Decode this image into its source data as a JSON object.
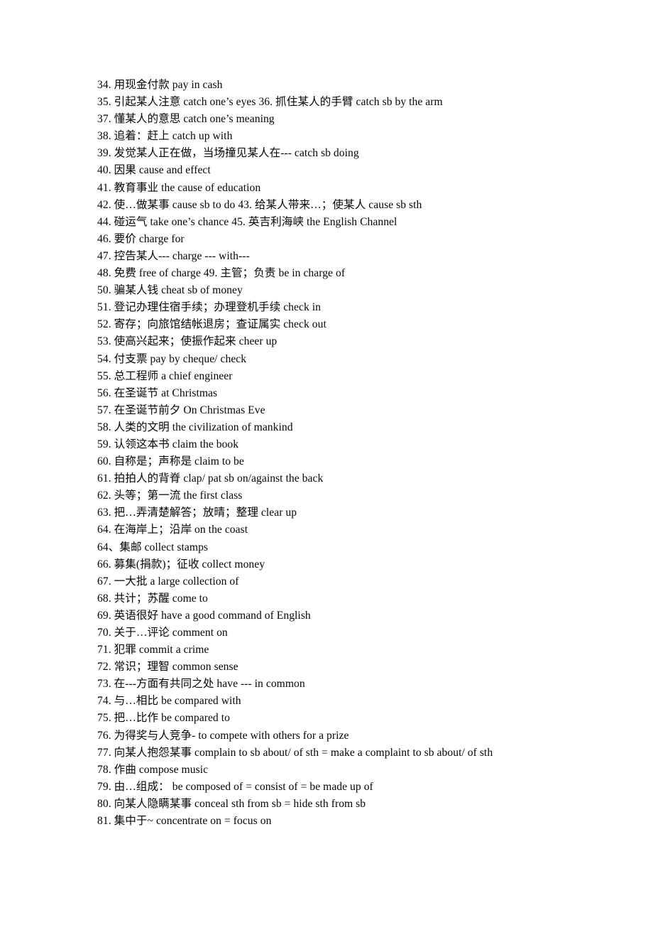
{
  "document": {
    "page_background": "#ffffff",
    "text_color": "#000000",
    "entries": [
      {
        "num": "34.",
        "text": "34.  用现金付款  pay in cash"
      },
      {
        "num": "35.",
        "text": "35.  引起某人注意  catch one’s eyes 36.  抓住某人的手臂  catch sb by the arm"
      },
      {
        "num": "37.",
        "text": "37.  懂某人的意思  catch one’s meaning"
      },
      {
        "num": "38.",
        "text": "38.  追着：赶上  catch up with"
      },
      {
        "num": "39.",
        "text": "39.  发觉某人正在做，当场撞见某人在--- catch sb doing"
      },
      {
        "num": "40.",
        "text": "40.  因果  cause and effect"
      },
      {
        "num": "41.",
        "text": "41.  教育事业  the cause of education"
      },
      {
        "num": "42.",
        "text": "42.  使…做某事  cause sb to do 43.  给某人带来…；使某人  cause sb sth"
      },
      {
        "num": "44.",
        "text": "44.  碰运气  take one’s chance 45.  英吉利海峡  the English Channel"
      },
      {
        "num": "46.",
        "text": "46.  要价  charge for"
      },
      {
        "num": "47.",
        "text": "47.  控告某人--- charge --- with---"
      },
      {
        "num": "48.",
        "text": "48.  免费  free of charge 49.  主管；负责  be in charge of"
      },
      {
        "num": "50.",
        "text": "50.  骗某人钱  cheat sb of money"
      },
      {
        "num": "51.",
        "text": "51.  登记办理住宿手续；办理登机手续  check in"
      },
      {
        "num": "52.",
        "text": "52.  寄存；向旅馆结帐退房；查证属实  check out"
      },
      {
        "num": "53.",
        "text": "53.  使高兴起来；使振作起来  cheer up"
      },
      {
        "num": "54.",
        "text": "54.  付支票  pay by cheque/ check"
      },
      {
        "num": "55.",
        "text": "55.  总工程师  a chief engineer"
      },
      {
        "num": "56.",
        "text": "56.  在圣诞节  at Christmas"
      },
      {
        "num": "57.",
        "text": "57.  在圣诞节前夕  On Christmas Eve"
      },
      {
        "num": "58.",
        "text": "58.  人类的文明 the civilization of mankind"
      },
      {
        "num": "59.",
        "text": "59.  认领这本书  claim the book"
      },
      {
        "num": "60.",
        "text": "60.  自称是；声称是  claim to be"
      },
      {
        "num": "61.",
        "text": "61.  拍拍人的背脊  clap/ pat sb on/against the back"
      },
      {
        "num": "62.",
        "text": "62.  头等；第一流  the first class"
      },
      {
        "num": "63.",
        "text": "63.  把…弄清楚解答；放晴；整理  clear up"
      },
      {
        "num": "64.",
        "text": "64.  在海岸上；沿岸  on the coast"
      },
      {
        "num": "64、",
        "text": "64、集邮  collect stamps"
      },
      {
        "num": "66.",
        "text": "66.  募集(捐款)；征收  collect money"
      },
      {
        "num": "67.",
        "text": "67.  一大批  a large collection of"
      },
      {
        "num": "68.",
        "text": "68.  共计；苏醒  come to"
      },
      {
        "num": "69.",
        "text": "69.  英语很好  have a good command of English"
      },
      {
        "num": "70.",
        "text": "70.  关于…评论  comment on"
      },
      {
        "num": "71.",
        "text": "71.  犯罪  commit a crime"
      },
      {
        "num": "72.",
        "text": "72.  常识；理智  common sense"
      },
      {
        "num": "73.",
        "text": "73.  在---方面有共同之处  have --- in common"
      },
      {
        "num": "74.",
        "text": "74.  与…相比  be compared with"
      },
      {
        "num": "75.",
        "text": "75.  把…比作  be compared to"
      },
      {
        "num": "76.",
        "text": "76.  为得奖与人竞争- to compete with others for a prize"
      },
      {
        "num": "77.",
        "text": "77.  向某人抱怨某事  complain to sb about/ of sth = make a complaint to sb about/ of sth"
      },
      {
        "num": "78.",
        "text": "78.  作曲  compose music"
      },
      {
        "num": "79.",
        "text": "79.  由…组成：    be composed of = consist of = be made up of"
      },
      {
        "num": "80.",
        "text": "80.  向某人隐瞒某事  conceal sth from sb = hide sth from sb"
      },
      {
        "num": "81.",
        "text": "81.  集中于~ concentrate on = focus on"
      }
    ]
  }
}
